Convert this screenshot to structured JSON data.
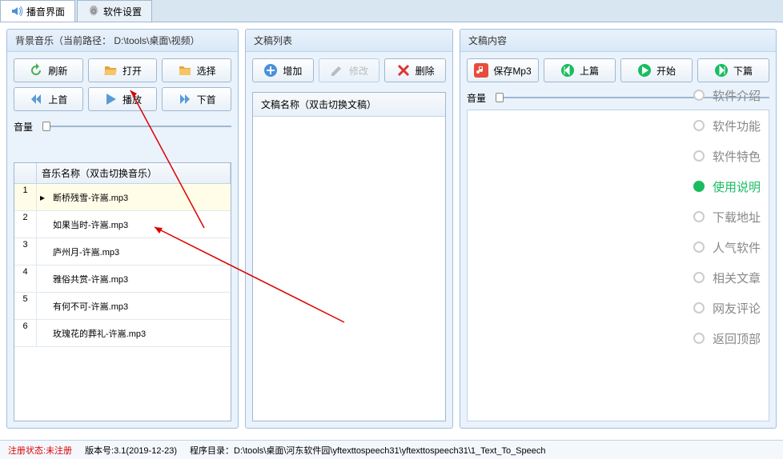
{
  "tabs": {
    "broadcast": "播音界面",
    "settings": "软件设置"
  },
  "bgmusic": {
    "title": "背景音乐（当前路径：  D:\\tools\\桌面\\视频）",
    "buttons": {
      "refresh": "刷新",
      "open": "打开",
      "select": "选择",
      "prev": "上首",
      "play": "播放",
      "next": "下首"
    },
    "volume_label": "音量",
    "table_header_name": "音乐名称（双击切换音乐）",
    "rows": [
      {
        "idx": "1",
        "name": "断桥残雪-许嵩.mp3"
      },
      {
        "idx": "2",
        "name": "如果当时-许嵩.mp3"
      },
      {
        "idx": "3",
        "name": "庐州月-许嵩.mp3"
      },
      {
        "idx": "4",
        "name": "雅俗共赏-许嵩.mp3"
      },
      {
        "idx": "5",
        "name": "有何不可-许嵩.mp3"
      },
      {
        "idx": "6",
        "name": "玫瑰花的葬礼-许嵩.mp3"
      }
    ]
  },
  "doclist": {
    "title": "文稿列表",
    "buttons": {
      "add": "增加",
      "edit": "修改",
      "delete": "删除"
    },
    "header": "文稿名称（双击切换文稿）"
  },
  "doccontent": {
    "title": "文稿内容",
    "buttons": {
      "save": "保存Mp3",
      "prev": "上篇",
      "start": "开始",
      "next": "下篇"
    },
    "volume_label": "音量"
  },
  "sidenav": [
    {
      "label": "软件介绍",
      "active": false
    },
    {
      "label": "软件功能",
      "active": false
    },
    {
      "label": "软件特色",
      "active": false
    },
    {
      "label": "使用说明",
      "active": true
    },
    {
      "label": "下载地址",
      "active": false
    },
    {
      "label": "人气软件",
      "active": false
    },
    {
      "label": "相关文章",
      "active": false
    },
    {
      "label": "网友评论",
      "active": false
    },
    {
      "label": "返回顶部",
      "active": false
    }
  ],
  "status": {
    "reg_label": "注册状态:",
    "reg_value": "未注册",
    "version_label": "版本号:",
    "version_value": "3.1(2019-12-23)",
    "path_label": "程序目录：",
    "path_value": "D:\\tools\\桌面\\河东软件园\\yftexttospeech31\\yftexttospeech31\\1_Text_To_Speech"
  }
}
